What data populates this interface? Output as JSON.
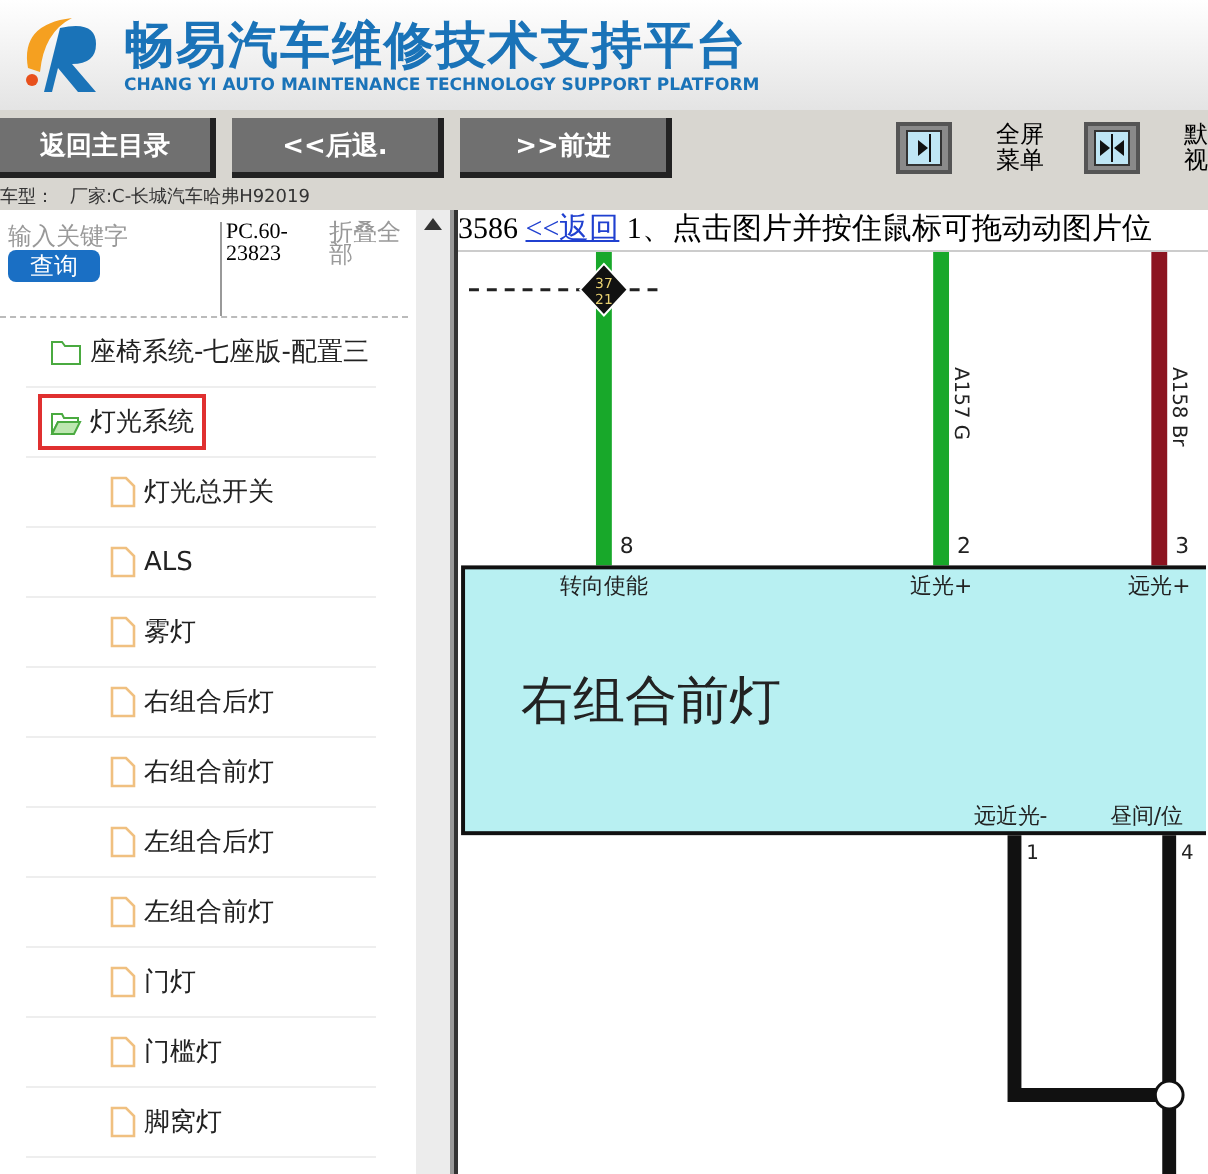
{
  "header": {
    "title": "畅易汽车维修技术支持平台",
    "subtitle": "CHANG YI AUTO MAINTENANCE TECHNOLOGY SUPPORT PLATFORM"
  },
  "toolbar": {
    "buttons": [
      "返回主目录",
      "<<后退.",
      ">>前进"
    ],
    "view_controls": [
      {
        "kind": "single",
        "lines": [
          "全屏",
          "菜单"
        ]
      },
      {
        "kind": "double",
        "lines": [
          "默",
          "视"
        ]
      }
    ]
  },
  "vehicle_info": [
    "车型：",
    "厂家:C-长城汽车哈弗H92019"
  ],
  "search": {
    "placeholder": "输入关键字",
    "button": "查询",
    "code": "PC.60-23823",
    "collapse_all": "折叠全部"
  },
  "tree": [
    {
      "label": "座椅系统-七座版-配置三",
      "expanded": false,
      "selected": false
    },
    {
      "label": "灯光系统",
      "expanded": true,
      "selected": true,
      "children": [
        {
          "label": "灯光总开关",
          "selected": false
        },
        {
          "label": "ALS",
          "selected": false
        },
        {
          "label": "雾灯",
          "selected": false
        },
        {
          "label": "右组合后灯",
          "selected": false
        },
        {
          "label": "右组合前灯",
          "selected": false
        },
        {
          "label": "左组合后灯",
          "selected": false
        },
        {
          "label": "左组合前灯",
          "selected": false
        },
        {
          "label": "门灯",
          "selected": false
        },
        {
          "label": "门槛灯",
          "selected": false
        },
        {
          "label": "脚窝灯",
          "selected": false
        }
      ]
    }
  ],
  "diagram": {
    "reference": "3586",
    "back_link": "<<返回",
    "instruction": "1、点击图片并按住鼠标可拖动动图片位",
    "splice": [
      "37",
      "21"
    ],
    "wires": [
      {
        "pin": "8",
        "color": "#18a82a"
      },
      {
        "label": "A157 G",
        "pin": "2",
        "color": "#18a82a"
      },
      {
        "label": "A158 Br",
        "pin": "3",
        "color": "#8c1420"
      }
    ],
    "component": {
      "name": "右组合前灯",
      "top_pins": [
        "转向使能",
        "近光+",
        "远光+"
      ],
      "bottom_pins": [
        {
          "label": "远近光-",
          "pin": "1"
        },
        {
          "label": "昼间/位",
          "pin": "4"
        }
      ]
    }
  }
}
